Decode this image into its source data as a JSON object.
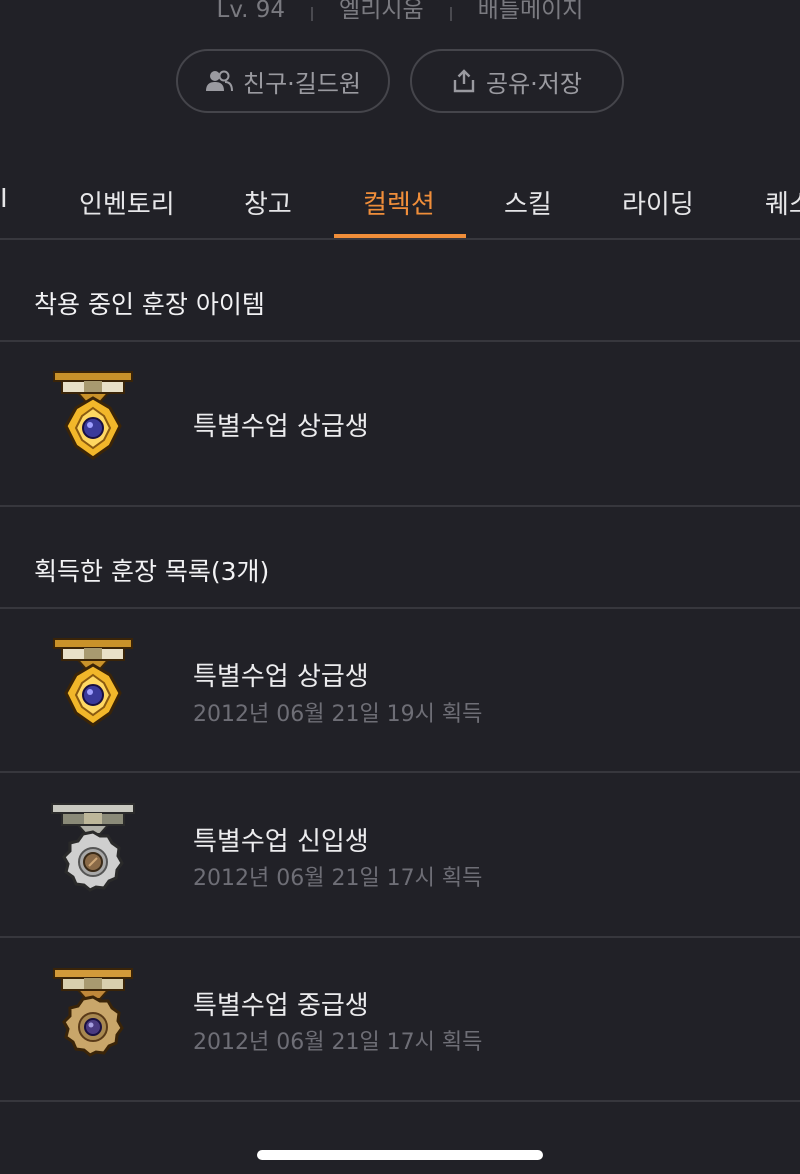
{
  "profile": {
    "level": "Lv. 94",
    "world": "엘리시움",
    "job": "배틀메이지"
  },
  "actions": {
    "friends_label": "친구·길드원",
    "share_label": "공유·저장"
  },
  "tabs": [
    {
      "label": "I"
    },
    {
      "label": "인벤토리"
    },
    {
      "label": "창고"
    },
    {
      "label": "컬렉션",
      "active": true
    },
    {
      "label": "스킬"
    },
    {
      "label": "라이딩"
    },
    {
      "label": "퀘스"
    }
  ],
  "equipped": {
    "title": "착용 중인 훈장 아이템",
    "item": {
      "name": "특별수업 상급생",
      "icon": "gold-medal-icon"
    }
  },
  "acquired": {
    "title": "획득한 훈장 목록(3개)",
    "items": [
      {
        "name": "특별수업 상급생",
        "date": "2012년 06월 21일 19시 획득",
        "icon": "gold-medal-icon"
      },
      {
        "name": "특별수업 신입생",
        "date": "2012년 06월 21일 17시 획득",
        "icon": "silver-medal-icon"
      },
      {
        "name": "특별수업 중급생",
        "date": "2012년 06월 21일 17시 획득",
        "icon": "bronze-medal-icon"
      }
    ]
  },
  "colors": {
    "background": "#212127",
    "accent": "#f08e3a",
    "divider": "#37373d",
    "muted_text": "#6e6e76"
  }
}
